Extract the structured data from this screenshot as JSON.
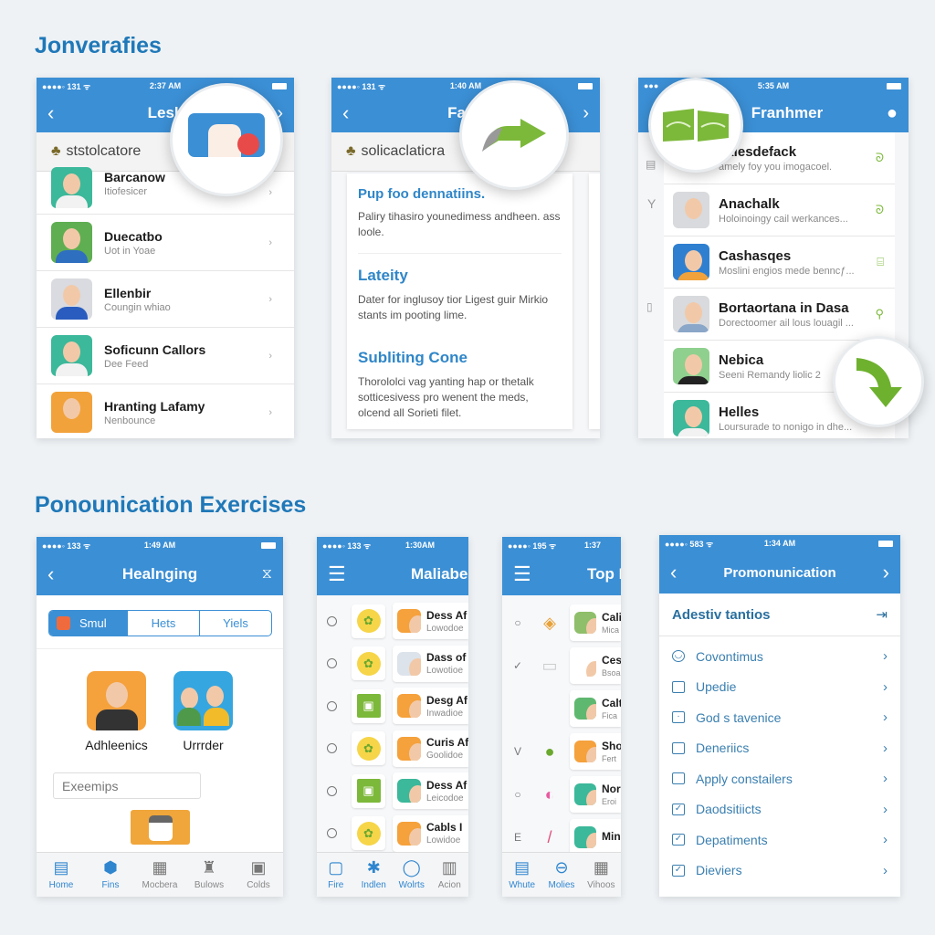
{
  "sections": {
    "top_title": "Jonverafies",
    "bottom_title": "Ponounication Exercises"
  },
  "colors": {
    "primary": "#3b8fd5",
    "accent_green": "#7cb83a",
    "title_blue": "#1f78b8"
  },
  "phone_a": {
    "status_left": "●●●●◦ 131 ᯤ",
    "time": "2:37 AM",
    "title": "Lesk",
    "search": "ststolcatore",
    "rows": [
      {
        "name": "Barcanow",
        "sub": "Itiofesicer",
        "bg": "#3cb89a",
        "shirt": "#f2f2f2"
      },
      {
        "name": "Duecatbo",
        "sub": "Uot in Yoae",
        "bg": "#5fae52",
        "shirt": "#2f6fc0"
      },
      {
        "name": "Ellenbir",
        "sub": "Coungin whiao",
        "bg": "#d9dbe0",
        "shirt": "#2a5cbf"
      },
      {
        "name": "Soficunn Callors",
        "sub": "Dee Feed",
        "bg": "#3cb89a",
        "shirt": "#f2f2f2"
      },
      {
        "name": "Hranting Lafamy",
        "sub": "Nenbounce",
        "bg": "#f2a23a",
        "shirt": "#f2a23a"
      }
    ]
  },
  "phone_b": {
    "status_left": "●●●●◦ 131 ᯤ",
    "time": "1:40 AM",
    "title": "Fash",
    "search": "solicaclaticra",
    "card": [
      {
        "heading": "Pup foo dennatiins.",
        "body": "Paliry tihasiro younedimess andheen. ass loole."
      },
      {
        "heading": "Lateity",
        "body": "Dater for inglusoy tior Ligest guir Mirkio stants im pooting lime."
      },
      {
        "heading": "Subliting Cone",
        "body": "Thorololci vag yanting hap or thetalk sotticesivess pro wenent the meds, olcend all Sorieti filet."
      }
    ]
  },
  "phone_c": {
    "time": "5:35 AM",
    "title": "Franhmer",
    "rows": [
      {
        "name": "xklesdefack",
        "sub": "amely foy you imogacoel.",
        "bg": "#ffffff",
        "shirt": "#ffffff"
      },
      {
        "name": "Anachalk",
        "sub": "Holoinoingy cail werkances...",
        "bg": "#d8dadd",
        "shirt": "#d8dadd"
      },
      {
        "name": "Cashasqes",
        "sub": "Moslini engios mede benncƒ...",
        "bg": "#2f7fd0",
        "shirt": "#f2a23a"
      },
      {
        "name": "Bortaortana in Dasa",
        "sub": "Dorectoomer ail lous louagil ...",
        "bg": "#d8dadd",
        "shirt": "#8aa6c8"
      },
      {
        "name": "Nebica",
        "sub": "Seeni Remandy liolic 2",
        "bg": "#8fd08f",
        "shirt": "#222222"
      },
      {
        "name": "Helles",
        "sub": "Loursurade to nonigo in dhe...",
        "bg": "#3cb89a",
        "shirt": "#f2f2f2"
      }
    ]
  },
  "phone_d": {
    "status_left": "●●●●◦ 133 ᯤ",
    "time": "1:49 AM",
    "title": "Healnging",
    "segments": [
      "Smul",
      "Hets",
      "Yiels"
    ],
    "cards": [
      {
        "label": "Adhleenics",
        "bg": "#f5a13c"
      },
      {
        "label": "Urrrder",
        "bg": "#35a6e0"
      }
    ],
    "input_value": "Exeemips",
    "tabs": [
      {
        "label": "Home",
        "icon": "▤"
      },
      {
        "label": "Fins",
        "icon": "⬢"
      },
      {
        "label": "Mocbera",
        "icon": "▦"
      },
      {
        "label": "Bulows",
        "icon": "♜"
      },
      {
        "label": "Colds",
        "icon": "▣"
      }
    ]
  },
  "phone_e": {
    "status_left": "●●●●◦ 133 ᯤ",
    "time": "1:30AM",
    "title": "Maliaber",
    "rows": [
      {
        "name": "Dess Af",
        "sub": "Lowodoe",
        "bg": "#f5a13c"
      },
      {
        "name": "Dass of",
        "sub": "Lowotioe",
        "bg": "#dde3ea"
      },
      {
        "name": "Desg Af",
        "sub": "Inwadioe",
        "bg": "#f5a13c"
      },
      {
        "name": "Curis Af",
        "sub": "Goolidoe",
        "bg": "#f5a13c"
      },
      {
        "name": "Dess Af",
        "sub": "Leicodoe",
        "bg": "#3cb89a"
      },
      {
        "name": "Cabls I",
        "sub": "Lowidoe",
        "bg": "#f5a13c"
      }
    ],
    "tabs": [
      {
        "label": "Fire",
        "icon": "▢"
      },
      {
        "label": "Indlen",
        "icon": "✱"
      },
      {
        "label": "Wolrts",
        "icon": "◯"
      },
      {
        "label": "Acion",
        "icon": "▥"
      }
    ]
  },
  "phone_f": {
    "status_left": "●●●●◦ 195 ᯤ",
    "time": "1:37",
    "title": "Top L",
    "marks": [
      "○",
      "✓",
      "",
      "V",
      "○",
      "E"
    ],
    "rows": [
      {
        "name": "Cali",
        "sub": "Mica",
        "bg": "#8fbf6a"
      },
      {
        "name": "Ces",
        "sub": "Bsoa",
        "bg": "#ffffff"
      },
      {
        "name": "Calt",
        "sub": "Fica",
        "bg": "#5fb870"
      },
      {
        "name": "Sho",
        "sub": "Fert",
        "bg": "#f5a13c"
      },
      {
        "name": "Nor",
        "sub": "Eroi",
        "bg": "#3cb89a"
      },
      {
        "name": "Min",
        "sub": "",
        "bg": "#3cb89a"
      }
    ],
    "tabs": [
      {
        "label": "Whute",
        "icon": "▤"
      },
      {
        "label": "Molies",
        "icon": "⊖"
      },
      {
        "label": "Vihoos",
        "icon": "▦"
      }
    ]
  },
  "phone_g": {
    "status_left": "●●●●◦ 583 ᯤ",
    "time": "1:34 AM",
    "title": "Promonunication",
    "section": "Adestiv tantios",
    "items": [
      {
        "label": "Covontimus",
        "icon": "◡",
        "checked": false
      },
      {
        "label": "Upedie",
        "icon": "",
        "checked": false
      },
      {
        "label": "God s tavenice",
        "icon": "·",
        "checked": false
      },
      {
        "label": "Deneriics",
        "icon": "",
        "checked": false
      },
      {
        "label": "Apply constailers",
        "icon": "",
        "checked": false
      },
      {
        "label": "Daodsitiicts",
        "icon": "✓",
        "checked": true
      },
      {
        "label": "Depatiments",
        "icon": "✓",
        "checked": true
      },
      {
        "label": "Dieviers",
        "icon": "✓",
        "checked": true
      }
    ]
  }
}
